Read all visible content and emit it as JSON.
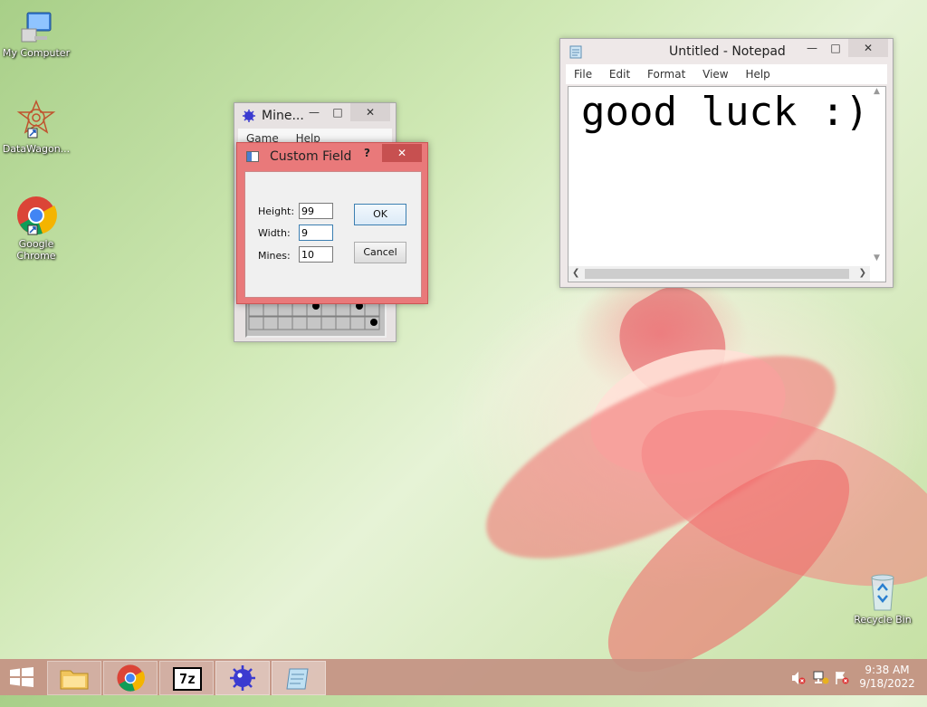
{
  "desktop": {
    "icons": [
      {
        "label": "My Computer"
      },
      {
        "label": "DataWagon..."
      },
      {
        "label": "Google Chrome"
      },
      {
        "label": "Recycle Bin"
      }
    ]
  },
  "minesweeper": {
    "title": "Mine...",
    "menu": [
      "Game",
      "Help"
    ]
  },
  "custom_field": {
    "title": "Custom Field",
    "help_glyph": "?",
    "fields": {
      "height_label": "Height:",
      "height_value": "99",
      "width_label": "Width:",
      "width_value": "9",
      "mines_label": "Mines:",
      "mines_value": "10"
    },
    "ok_label": "OK",
    "cancel_label": "Cancel"
  },
  "notepad": {
    "title": "Untitled - Notepad",
    "menu": [
      "File",
      "Edit",
      "Format",
      "View",
      "Help"
    ],
    "content": "good luck :)"
  },
  "taskbar": {
    "time": "9:38 AM",
    "date": "9/18/2022",
    "sevenzip_text": "7z"
  },
  "colors": {
    "dialog_frame": "#e9797a",
    "close_button": "#c75050",
    "taskbar": "#c39182"
  }
}
